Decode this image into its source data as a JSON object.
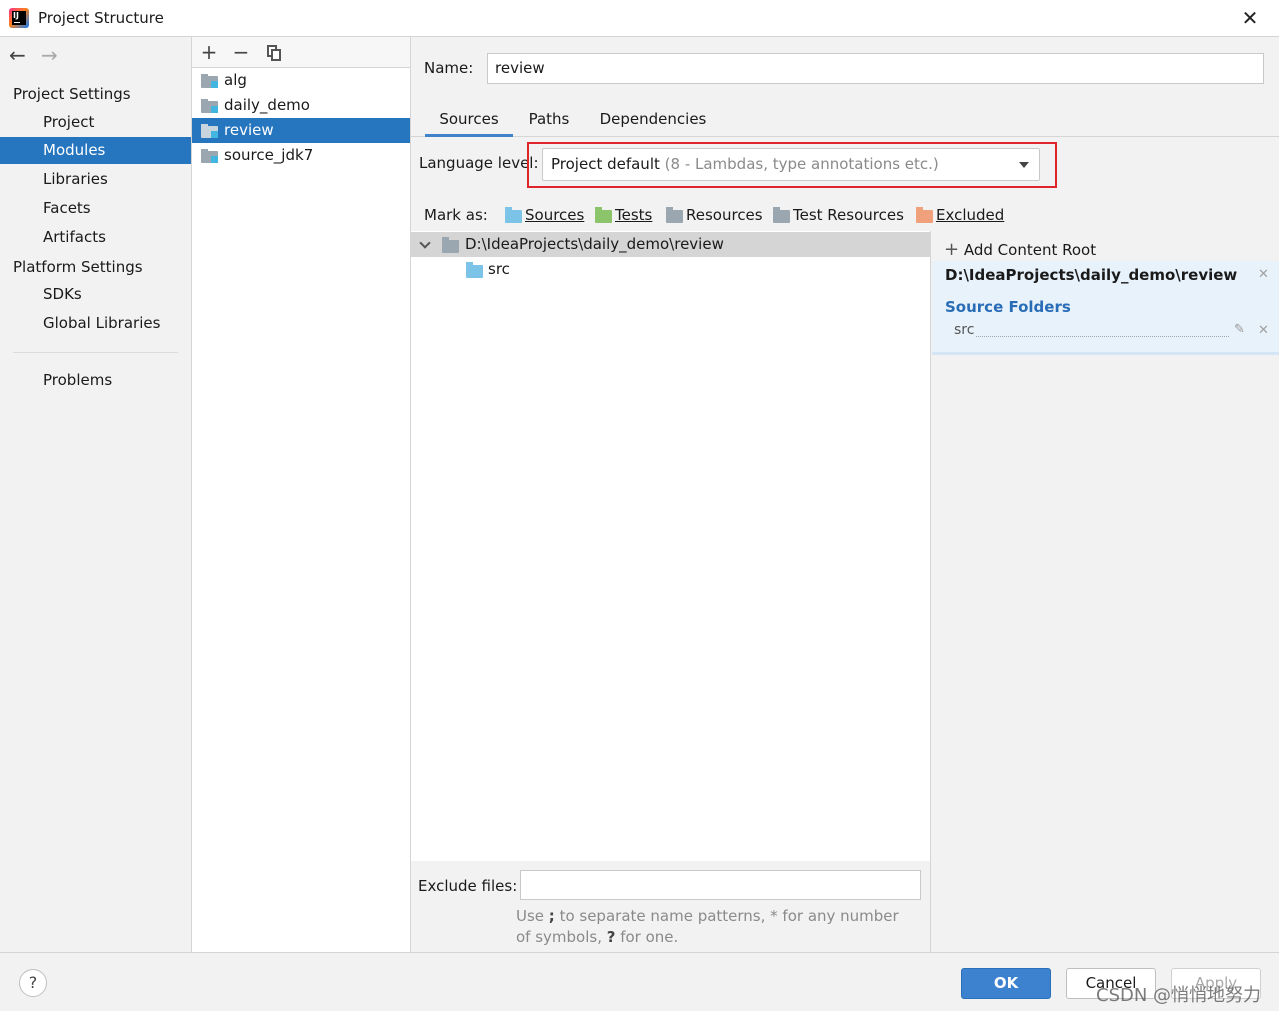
{
  "window": {
    "title": "Project Structure",
    "close": "✕",
    "app_icon_letters": "IJ"
  },
  "nav": {
    "back": "←",
    "forward": "→",
    "project_settings_header": "Project Settings",
    "project_settings": [
      "Project",
      "Modules",
      "Libraries",
      "Facets",
      "Artifacts"
    ],
    "platform_settings_header": "Platform Settings",
    "platform_settings": [
      "SDKs",
      "Global Libraries"
    ],
    "problems": "Problems",
    "selected": "Modules"
  },
  "modules": {
    "toolbar": {
      "add": "+",
      "remove": "−"
    },
    "items": [
      "alg",
      "daily_demo",
      "review",
      "source_jdk7"
    ],
    "selected": "review"
  },
  "module_detail": {
    "name_label": "Name:",
    "name_value": "review",
    "tabs": [
      "Sources",
      "Paths",
      "Dependencies"
    ],
    "active_tab": "Sources",
    "language_level_label": "Language level:",
    "language_level_value": "Project default",
    "language_level_hint": "(8 - Lambdas, type annotations etc.)",
    "highlight_color": "#e0242b",
    "mark_as_label": "Mark as:",
    "mark_as": [
      {
        "label": "Sources",
        "color": "#7cc3e8"
      },
      {
        "label": "Tests",
        "color": "#8cc46c"
      },
      {
        "label": "Resources",
        "color": "#9aa7b0"
      },
      {
        "label": "Test Resources",
        "color": "#9aa7b0"
      },
      {
        "label": "Excluded",
        "color": "#f0a07a"
      }
    ],
    "tree": {
      "root": "D:\\IdeaProjects\\daily_demo\\review",
      "children": [
        "src"
      ]
    },
    "exclude_files_label": "Exclude files:",
    "exclude_files_value": "",
    "exclude_hint_part1": "Use ",
    "exclude_hint_semicolon": ";",
    "exclude_hint_part2": " to separate name patterns, * for any number of symbols, ",
    "exclude_hint_question": "?",
    "exclude_hint_part3": " for one.",
    "content_roots": {
      "add_label": "Add Content Root",
      "root_path": "D:\\IdeaProjects\\daily_demo\\review",
      "source_folders_label": "Source Folders",
      "source_folders": [
        "src"
      ]
    }
  },
  "footer": {
    "help": "?",
    "ok": "OK",
    "cancel": "Cancel",
    "apply": "Apply",
    "watermark": "CSDN @悄悄地努力"
  }
}
